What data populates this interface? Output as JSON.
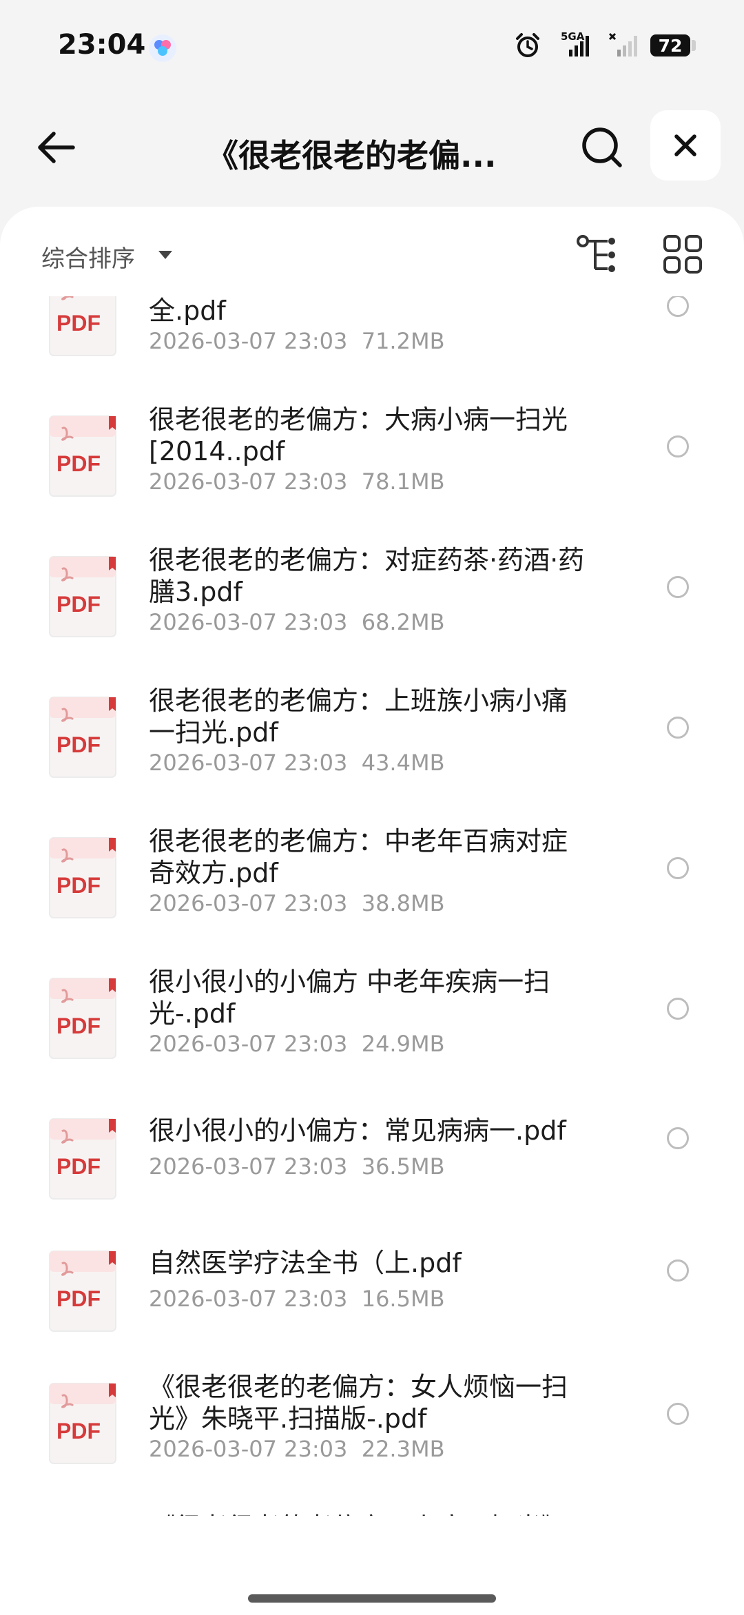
{
  "status": {
    "time": "23:04",
    "network": "5GA",
    "battery": "72"
  },
  "header": {
    "title": "《很老很老的老偏..."
  },
  "toolbar": {
    "sort_label": "综合排序"
  },
  "files": [
    {
      "name": "很老很老的老偏方大全集：日常小病全.pdf",
      "date": "2026-03-07 23:03",
      "size": "71.2MB"
    },
    {
      "name": "很老很老的老偏方：大病小病一扫光[2014..pdf",
      "date": "2026-03-07 23:03",
      "size": "78.1MB"
    },
    {
      "name": "很老很老的老偏方：对症药茶·药酒·药膳3.pdf",
      "date": "2026-03-07 23:03",
      "size": "68.2MB"
    },
    {
      "name": "很老很老的老偏方：上班族小病小痛一扫光.pdf",
      "date": "2026-03-07 23:03",
      "size": "43.4MB"
    },
    {
      "name": "很老很老的老偏方：中老年百病对症奇效方.pdf",
      "date": "2026-03-07 23:03",
      "size": "38.8MB"
    },
    {
      "name": "很小很小的小偏方 中老年疾病一扫光-.pdf",
      "date": "2026-03-07 23:03",
      "size": "24.9MB"
    },
    {
      "name": "很小很小的小偏方：常见病病一.pdf",
      "date": "2026-03-07 23:03",
      "size": "36.5MB"
    },
    {
      "name": "自然医学疗法全书（上.pdf",
      "date": "2026-03-07 23:03",
      "size": "16.5MB"
    },
    {
      "name": "《很老很老的老偏方：女人烦恼一扫光》朱晓平.扫描版-.pdf",
      "date": "2026-03-07 23:03",
      "size": "22.3MB"
    },
    {
      "name": "《很老很老的老偏方：小病一扫光》朱晓平.扫描版-.pdf",
      "date": "",
      "size": ""
    }
  ],
  "icon_label": "PDF",
  "colors": {
    "pdf_red": "#d63a3a",
    "background": "#f4f4f4",
    "sheet": "#ffffff"
  }
}
